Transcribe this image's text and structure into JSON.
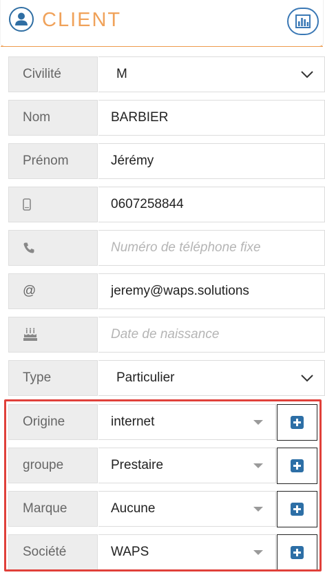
{
  "header": {
    "title": "CLIENT",
    "user_icon": "user-icon",
    "stats_icon": "bar-chart-icon",
    "accent": "#f0a25a",
    "icon_color": "#2f6ea3"
  },
  "form": {
    "civilite": {
      "label": "Civilité",
      "value": "M"
    },
    "nom": {
      "label": "Nom",
      "value": "BARBIER"
    },
    "prenom": {
      "label": "Prénom",
      "value": "Jérémy"
    },
    "mobile": {
      "icon": "mobile-phone-icon",
      "value": "0607258844"
    },
    "fixe": {
      "icon": "phone-icon",
      "placeholder": "Numéro de téléphone fixe"
    },
    "email": {
      "label": "@",
      "value": "jeremy@waps.solutions"
    },
    "naissance": {
      "icon": "birthday-cake-icon",
      "placeholder": "Date de naissance"
    },
    "type": {
      "label": "Type",
      "value": "Particulier"
    },
    "origine": {
      "label": "Origine",
      "value": "internet"
    },
    "groupe": {
      "label": "groupe",
      "value": "Prestaire"
    },
    "marque": {
      "label": "Marque",
      "value": "Aucune"
    },
    "societe": {
      "label": "Société",
      "value": "WAPS"
    }
  },
  "highlight_color": "#e0403a"
}
